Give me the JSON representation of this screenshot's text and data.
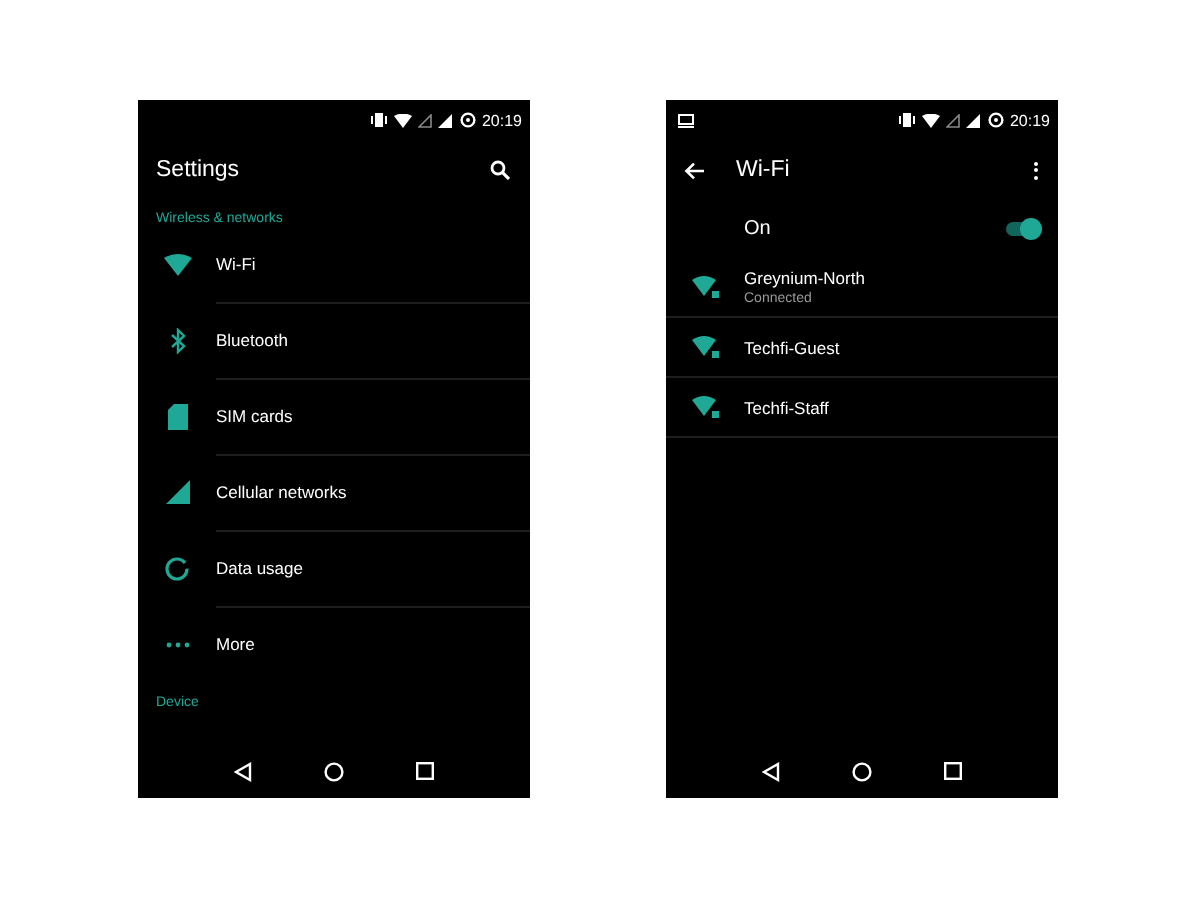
{
  "screens": [
    {
      "kind": "settings",
      "status_bar": {
        "time": "20:19"
      },
      "toolbar": {
        "title": "Settings"
      },
      "sections": [
        {
          "header": "Wireless & networks",
          "items": [
            {
              "label": "Wi-Fi",
              "kind": "wifi"
            },
            {
              "label": "Bluetooth",
              "kind": "bluetooth"
            },
            {
              "label": "SIM cards",
              "kind": "sim"
            },
            {
              "label": "Cellular networks",
              "kind": "signal"
            },
            {
              "label": "Data usage",
              "kind": "data"
            },
            {
              "label": "More",
              "kind": "more"
            }
          ]
        },
        {
          "header": "Device"
        }
      ]
    },
    {
      "kind": "wifi",
      "status_bar": {
        "time": "20:19"
      },
      "toolbar": {
        "title": "Wi-Fi"
      },
      "switch": {
        "label": "On",
        "on": true
      },
      "networks": [
        {
          "name": "Greynium-North",
          "status": "Connected"
        },
        {
          "name": "Techfi-Guest"
        },
        {
          "name": "Techfi-Staff"
        }
      ]
    }
  ]
}
